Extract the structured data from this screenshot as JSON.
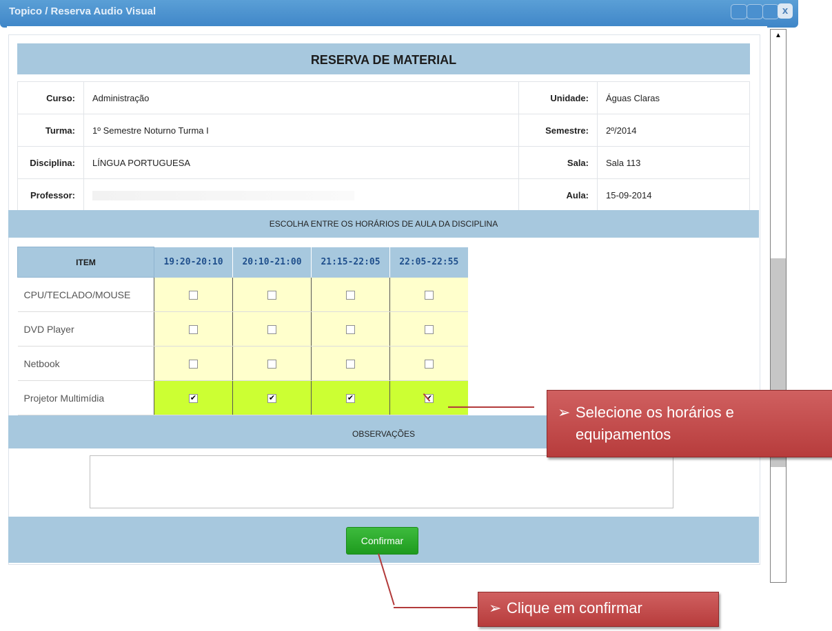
{
  "window": {
    "title": "Topico / Reserva Audio Visual",
    "close_glyph": "x",
    "controls": [
      "minimize-icon",
      "maximize-icon",
      "restore-icon",
      "close-icon"
    ]
  },
  "form": {
    "title": "RESERVA DE MATERIAL",
    "info": {
      "curso_label": "Curso:",
      "curso": "Administração",
      "unidade_label": "Unidade:",
      "unidade": "Águas Claras",
      "turma_label": "Turma:",
      "turma": "1º Semestre Noturno Turma I",
      "semestre_label": "Semestre:",
      "semestre": "2º/2014",
      "disciplina_label": "Disciplina:",
      "disciplina": "LÍNGUA PORTUGUESA",
      "sala_label": "Sala:",
      "sala": "Sala 113",
      "professor_label": "Professor:",
      "professor": "",
      "aula_label": "Aula:",
      "aula": "15-09-2014"
    },
    "schedule_heading": "ESCOLHA ENTRE OS HORÁRIOS DE AULA DA DISCIPLINA",
    "schedule": {
      "item_header": "ITEM",
      "times": [
        "19:20-20:10",
        "20:10-21:00",
        "21:15-22:05",
        "22:05-22:55"
      ],
      "rows": [
        {
          "item": "CPU/TECLADO/MOUSE",
          "checked": [
            false,
            false,
            false,
            false
          ]
        },
        {
          "item": "DVD Player",
          "checked": [
            false,
            false,
            false,
            false
          ]
        },
        {
          "item": "Netbook",
          "checked": [
            false,
            false,
            false,
            false
          ]
        },
        {
          "item": "Projetor Multimídia",
          "checked": [
            true,
            true,
            true,
            true
          ]
        }
      ],
      "check_mark": "✔"
    },
    "observacoes_label": "OBSERVAÇÕES",
    "observacoes_value": "",
    "confirm_label": "Confirmar"
  },
  "callouts": {
    "arrow": "➢",
    "select": [
      "Selecione os horários e",
      "equipamentos"
    ],
    "confirm": "Clique em confirmar"
  },
  "colors": {
    "band": "#a7c8de",
    "cell_unselected": "#ffffcc",
    "cell_selected": "#ccff33",
    "confirm_button": "#2aa52a",
    "callout": "#c24a4a"
  }
}
